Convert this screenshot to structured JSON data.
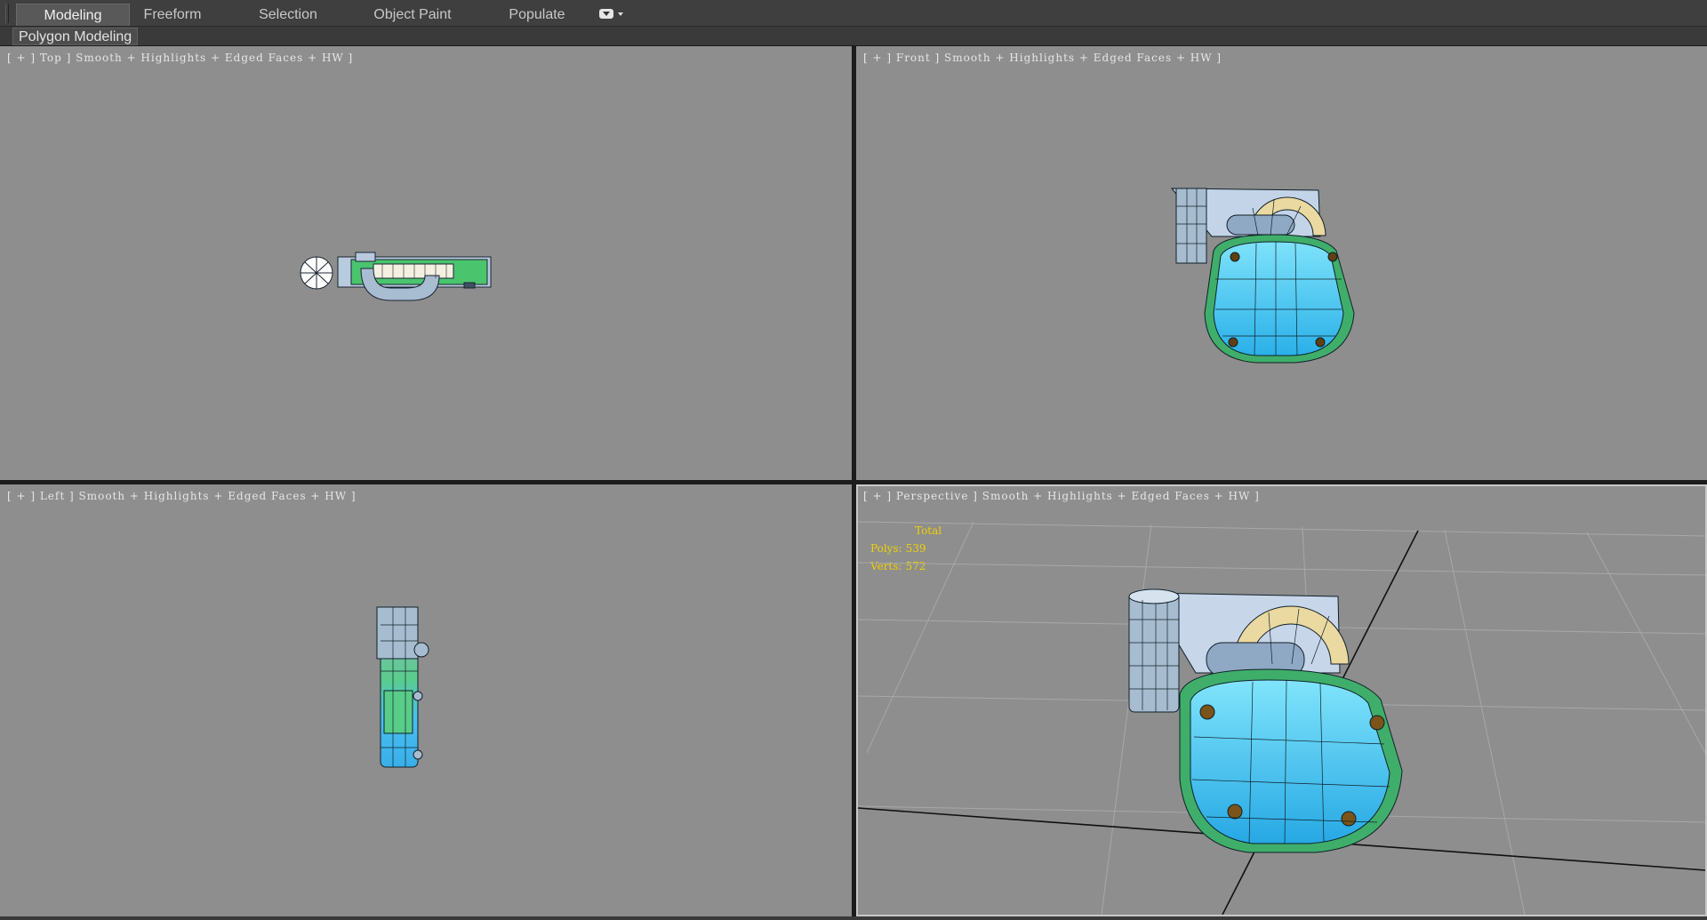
{
  "ribbon": {
    "tabs": [
      {
        "label": "Modeling",
        "active": true
      },
      {
        "label": "Freeform",
        "active": false
      },
      {
        "label": "Selection",
        "active": false
      },
      {
        "label": "Object Paint",
        "active": false
      },
      {
        "label": "Populate",
        "active": false
      }
    ],
    "panel_label": "Polygon Modeling"
  },
  "viewports": {
    "top": {
      "label": "[ + ] Top ] Smooth + Highlights + Edged Faces + HW ]"
    },
    "front": {
      "label": "[ + ] Front ] Smooth + Highlights + Edged Faces + HW ]"
    },
    "left": {
      "label": "[ + ] Left ] Smooth + Highlights + Edged Faces + HW ]"
    },
    "perspective": {
      "label": "[ + ] Perspective ] Smooth + Highlights + Edged Faces + HW ]"
    }
  },
  "stats": {
    "total_label": "Total",
    "polys_label": "Polys:",
    "polys_value": "539",
    "verts_label": "Verts:",
    "verts_value": "572"
  },
  "colors": {
    "viewport_bg": "#8e8e8e",
    "stats_text": "#f0d000",
    "body_blue": "#5ad0f2",
    "trim_green": "#3fae6a",
    "fan_cream": "#ead9a0",
    "metal": "#c8d4e4"
  },
  "icons": [
    "ribbon-minimize-icon",
    "dropdown-caret-icon"
  ]
}
